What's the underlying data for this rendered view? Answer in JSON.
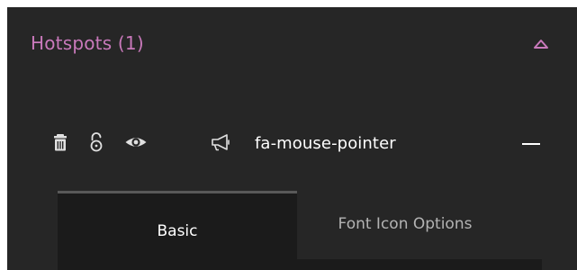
{
  "panel": {
    "title": "Hotspots (1)",
    "colors": {
      "background": "#262626",
      "title": "#c979bb",
      "active_tab_bg": "#1b1b1b"
    }
  },
  "hotspot": {
    "name": "fa-mouse-pointer",
    "icons": [
      "trash-icon",
      "unlock-icon",
      "eye-icon",
      "bullhorn-icon",
      "minus-icon"
    ]
  },
  "tabs": [
    {
      "label": "Basic",
      "active": true
    },
    {
      "label": "Font Icon Options",
      "active": false
    }
  ]
}
